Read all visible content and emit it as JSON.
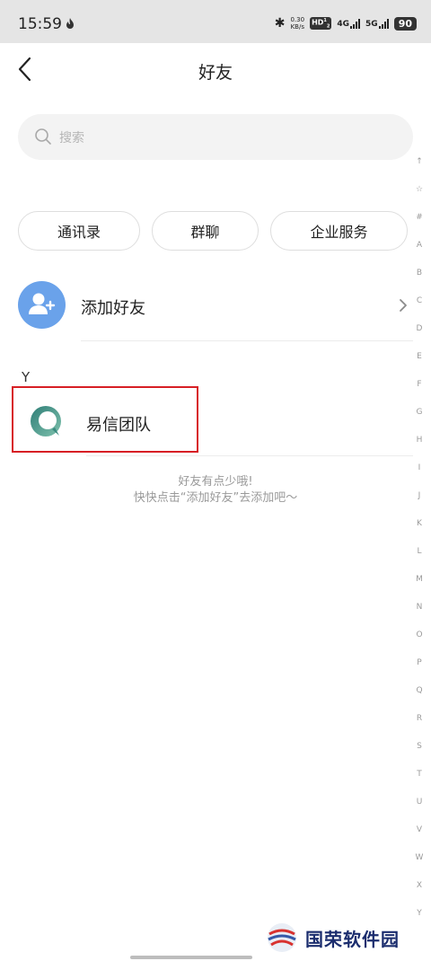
{
  "status_bar": {
    "time": "15:59",
    "speed_value": "0.30",
    "speed_unit": "KB/s",
    "hd_badge": "HD",
    "hd_sim": "1",
    "hd_sim2": "2",
    "network_4g": "4G",
    "network_5g": "5G",
    "battery": "90",
    "icons": [
      "flame-icon",
      "bluetooth-icon",
      "signal-icon",
      "battery-icon"
    ]
  },
  "header": {
    "title": "好友",
    "back_icon": "back-chevron-icon"
  },
  "search": {
    "placeholder": "搜索"
  },
  "tabs": [
    {
      "label": "通讯录"
    },
    {
      "label": "群聊"
    },
    {
      "label": "企业服务"
    }
  ],
  "add_friend": {
    "label": "添加好友",
    "icon": "add-user-icon"
  },
  "section_letter": "Y",
  "contacts": [
    {
      "name": "易信团队"
    }
  ],
  "empty_hint": {
    "line1": "好友有点少哦!",
    "line2": "快快点击“添加好友”去添加吧～"
  },
  "alpha_index": [
    "↑",
    "☆",
    "#",
    "A",
    "B",
    "C",
    "D",
    "E",
    "F",
    "G",
    "H",
    "I",
    "J",
    "K",
    "L",
    "M",
    "N",
    "O",
    "P",
    "Q",
    "R",
    "S",
    "T",
    "U",
    "V",
    "W",
    "X",
    "Y"
  ],
  "watermark": {
    "text": "国荣软件园"
  },
  "colors": {
    "accent_blue": "#6aa2ea",
    "highlight_red": "#d71f25",
    "avatar_teal": "#3e8e84"
  }
}
